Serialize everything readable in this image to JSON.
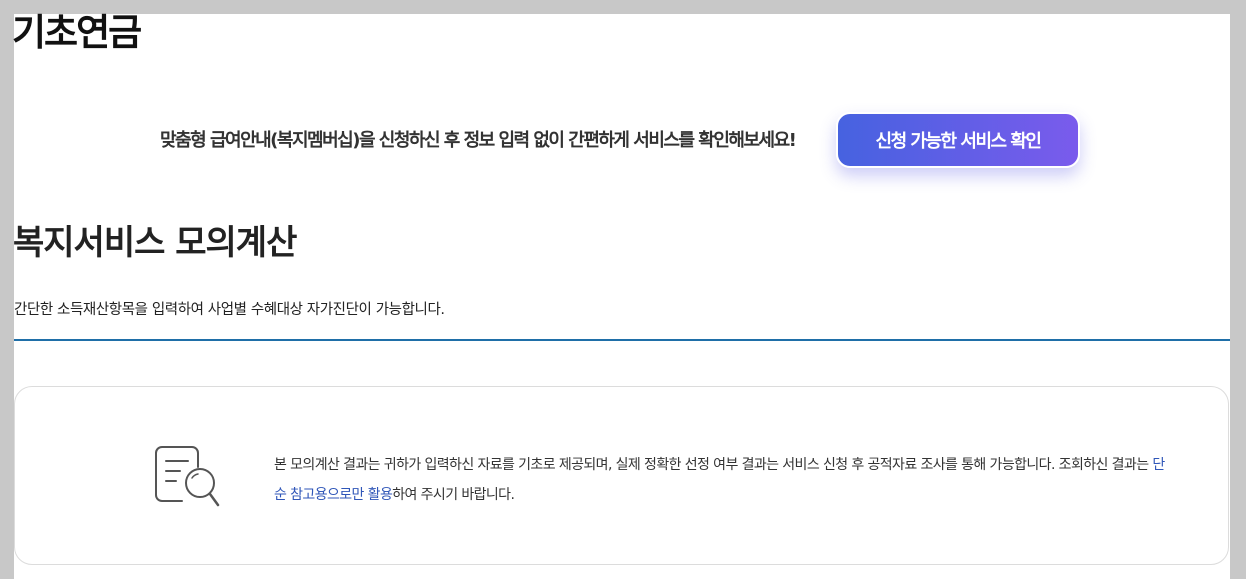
{
  "page": {
    "title": "기초연금"
  },
  "banner": {
    "text": "맞춤형 급여안내(복지멤버십)을 신청하신 후 정보 입력 없이 간편하게 서비스를 확인해보세요!",
    "button_label": "신청 가능한 서비스 확인"
  },
  "simulation": {
    "title": "복지서비스 모의계산",
    "description": "간단한 소득재산항목을 입력하여 사업별 수혜대상 자가진단이 가능합니다."
  },
  "notice": {
    "icon": "document-search-icon",
    "text_before": "본 모의계산 결과는 귀하가 입력하신 자료를 기초로 제공되며, 실제 정확한 선정 여부 결과는 서비스 신청 후 공적자료 조사를 통해 가능합니다. 조회하신 결과는 ",
    "highlight": "단순 참고용으로만 활용",
    "text_after": "하여 주시기 바랍니다."
  },
  "colors": {
    "button_gradient_start": "#4662e0",
    "button_gradient_end": "#7a5bec",
    "divider": "#1f6fa8",
    "highlight": "#2f56b8"
  }
}
